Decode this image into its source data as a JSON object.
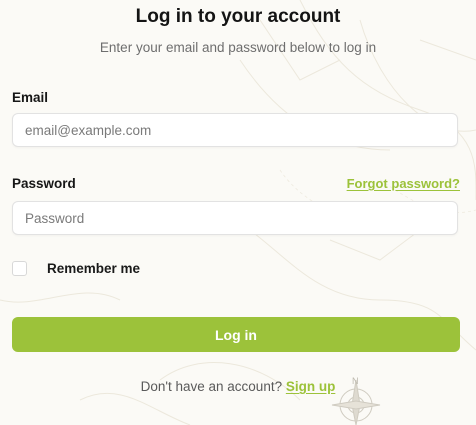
{
  "header": {
    "title": "Log in to your account",
    "subtitle": "Enter your email and password below to log in"
  },
  "form": {
    "email_label": "Email",
    "email_placeholder": "email@example.com",
    "password_label": "Password",
    "forgot_link": "Forgot password?",
    "password_placeholder": "Password",
    "remember_label": "Remember me",
    "remember_checked": false,
    "submit_label": "Log in"
  },
  "footer": {
    "prompt": "Don't have an account? ",
    "signup_link": "Sign up"
  },
  "theme": {
    "accent": "#9cc23a",
    "background": "#fbfaf6"
  },
  "icons": {
    "background": "map-pattern",
    "compass": "compass-rose-icon"
  }
}
